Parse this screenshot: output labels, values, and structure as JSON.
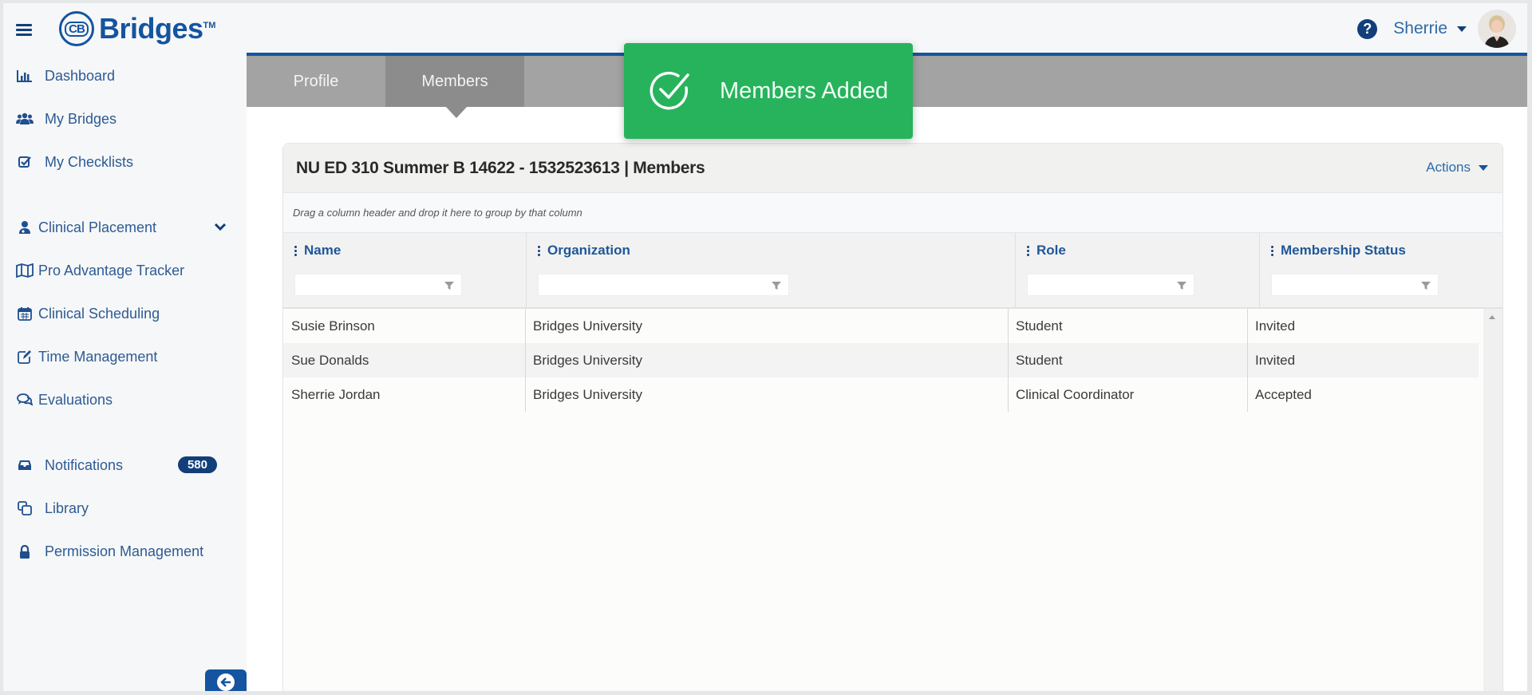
{
  "app": {
    "logo_mark": "CB",
    "logo_text": "Bridges",
    "logo_tm": "TM"
  },
  "user": {
    "name": "Sherrie",
    "help_icon": "question-circle-icon"
  },
  "sidebar": {
    "items": [
      {
        "label": "Dashboard",
        "icon": "bar-chart-icon"
      },
      {
        "label": "My Bridges",
        "icon": "users-icon"
      },
      {
        "label": "My Checklists",
        "icon": "checkbox-icon"
      },
      {
        "label": "Clinical Placement",
        "icon": "user-md-icon",
        "expandable": true
      },
      {
        "label": "Pro Advantage Tracker",
        "icon": "map-icon"
      },
      {
        "label": "Clinical Scheduling",
        "icon": "calendar-icon"
      },
      {
        "label": "Time Management",
        "icon": "edit-icon"
      },
      {
        "label": "Evaluations",
        "icon": "comments-icon"
      },
      {
        "label": "Notifications",
        "icon": "inbox-icon",
        "badge": "580"
      },
      {
        "label": "Library",
        "icon": "copy-icon"
      },
      {
        "label": "Permission Management",
        "icon": "lock-icon"
      }
    ]
  },
  "tabs": [
    {
      "label": "Profile",
      "active": false
    },
    {
      "label": "Members",
      "active": true
    }
  ],
  "toast": {
    "message": "Members Added",
    "color": "#27b35c"
  },
  "panel": {
    "title": "NU ED 310 Summer B 14622 - 1532523613 | Members",
    "actions_label": "Actions",
    "group_hint": "Drag a column header and drop it here to group by that column"
  },
  "grid": {
    "columns": [
      {
        "label": "Name",
        "filter_value": ""
      },
      {
        "label": "Organization",
        "filter_value": ""
      },
      {
        "label": "Role",
        "filter_value": ""
      },
      {
        "label": "Membership Status",
        "filter_value": ""
      }
    ],
    "rows": [
      {
        "name": "Susie Brinson",
        "organization": "Bridges University",
        "role": "Student",
        "status": "Invited"
      },
      {
        "name": "Sue Donalds",
        "organization": "Bridges University",
        "role": "Student",
        "status": "Invited"
      },
      {
        "name": "Sherrie Jordan",
        "organization": "Bridges University",
        "role": "Clinical Coordinator",
        "status": "Accepted"
      }
    ]
  },
  "colors": {
    "brand_blue": "#1454a0",
    "nav_text": "#2d5b94",
    "tab_bar": "#a3a3a3",
    "tab_active": "#8c8c8c"
  }
}
